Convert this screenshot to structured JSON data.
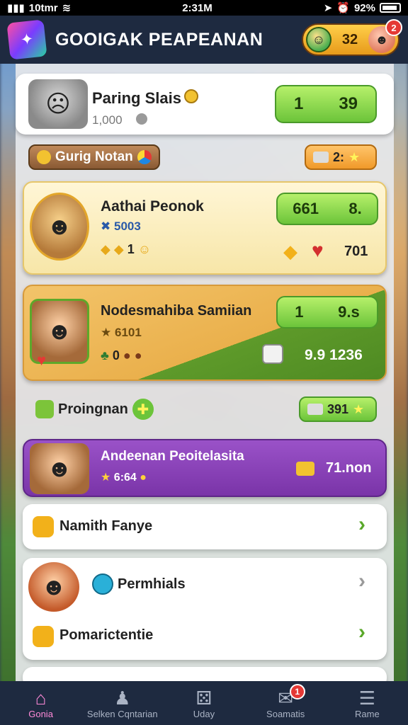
{
  "status_bar": {
    "carrier": "10tmr",
    "time": "2:31M",
    "battery": "92%"
  },
  "header": {
    "title": "GOOIGAK PEAPEANAN",
    "coins": "32",
    "notification_count": "2"
  },
  "profile_card": {
    "name": "Paring Slais",
    "sub_value": "1,000",
    "button_left": "1",
    "button_right": "39"
  },
  "section1": {
    "label": "Gurig Notan",
    "tag_value": "2:"
  },
  "card1": {
    "title": "Aathai Peonok",
    "stat": "5003",
    "small_value": "1",
    "button_left": "661",
    "button_right": "8.",
    "right_value": "701"
  },
  "card2": {
    "title": "Nodesmahiba Samiian",
    "stat": "6101",
    "small_value": "0",
    "button_left": "1",
    "button_right": "9.s",
    "value_left": "9.9",
    "value_right": "1236"
  },
  "section2": {
    "label": "Proingnan",
    "tag_value": "391"
  },
  "purple_card": {
    "title": "Andeenan Peoitelasita",
    "stat": "6:64",
    "right_value": "71.non"
  },
  "rows": [
    {
      "label": "Namith Fanye"
    },
    {
      "label": "Permhials"
    },
    {
      "label": "Pomarictentie"
    }
  ],
  "bottom_nav": [
    {
      "label": "Gonia",
      "icon": "home-icon"
    },
    {
      "label": "Selken Cqntarian",
      "icon": "users-icon"
    },
    {
      "label": "Uday",
      "icon": "dice-icon"
    },
    {
      "label": "Soamatis",
      "icon": "chat-icon",
      "badge": "1"
    },
    {
      "label": "Rame",
      "icon": "menu-icon"
    }
  ],
  "colors": {
    "header_bg": "#1e2a40",
    "accent_green": "#6cc43a",
    "accent_gold": "#f3c46a",
    "accent_purple": "#8a44b8",
    "badge_red": "#e53935"
  }
}
